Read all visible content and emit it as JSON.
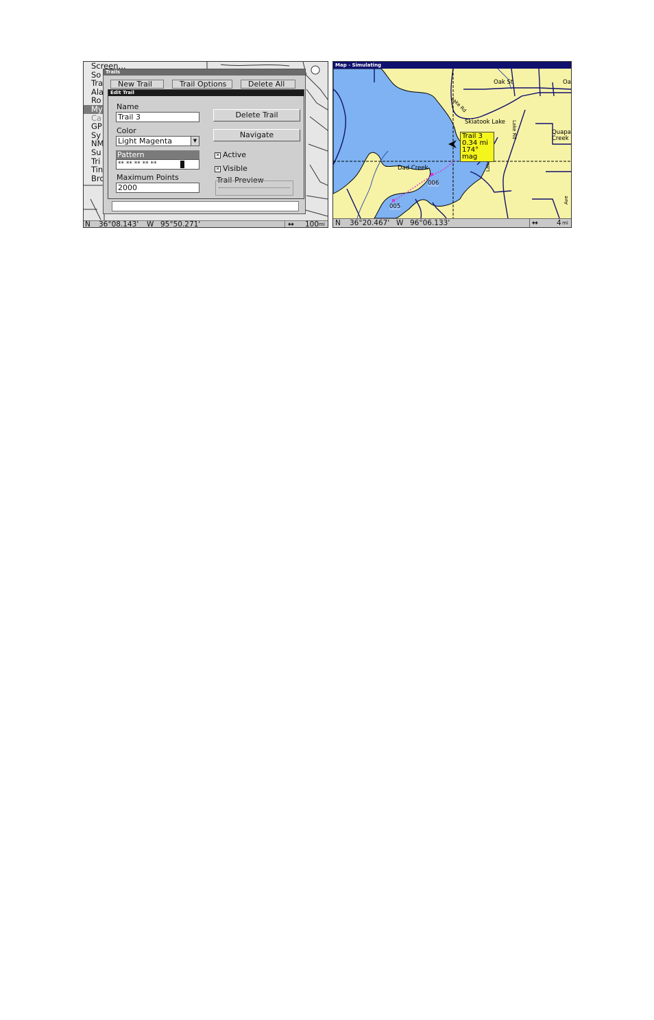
{
  "left_screen": {
    "menu_items": [
      {
        "label": "Screen...",
        "state": "normal"
      },
      {
        "label": "So",
        "state": "normal"
      },
      {
        "label": "Tra",
        "state": "normal"
      },
      {
        "label": "Ala",
        "state": "normal"
      },
      {
        "label": "Ro",
        "state": "normal"
      },
      {
        "label": "My",
        "state": "selected"
      },
      {
        "label": "Ca",
        "state": "dim"
      },
      {
        "label": "GP",
        "state": "normal"
      },
      {
        "label": "Sy",
        "state": "normal"
      },
      {
        "label": "NM",
        "state": "normal"
      },
      {
        "label": "Su",
        "state": "normal"
      },
      {
        "label": "Tri",
        "state": "normal"
      },
      {
        "label": "Tin",
        "state": "normal"
      },
      {
        "label": "Bro",
        "state": "normal"
      }
    ],
    "trails_dialog": {
      "title": "Trails",
      "buttons": [
        "New Trail",
        "Trail Options",
        "Delete All"
      ]
    },
    "edit_trail": {
      "title": "Edit Trail",
      "name_label": "Name",
      "name_value": "Trail 3",
      "color_label": "Color",
      "color_value": "Light Magenta",
      "pattern_label": "Pattern",
      "pattern_value": "** ** ** ** **",
      "max_points_label": "Maximum Points",
      "max_points_value": "2000",
      "delete_button": "Delete Trail",
      "navigate_button": "Navigate",
      "active_label": "Active",
      "visible_label": "Visible",
      "active_checked": true,
      "visible_checked": true,
      "preview_label": "Trail Preview"
    },
    "status": {
      "lat_hemi": "N",
      "lat": "36°08.143'",
      "lon_hemi": "W",
      "lon": "95°50.271'",
      "zoom_arrow": "↔",
      "zoom_value": "100",
      "zoom_unit": "mi"
    }
  },
  "right_screen": {
    "title": "Map - Simulating",
    "labels": {
      "oak_st": "Oak St",
      "oak_right": "Oa",
      "skiatook": "Skiatook Lake",
      "lake_rd_top": "Lake Rd",
      "lake_rd_bottom": "Lake Rd",
      "quapaw": "Quapa",
      "creek": "Creek",
      "dad_creek": "Dad Creek",
      "wp_006": "006",
      "wp_005": "005",
      "lake_rd_diag": "Lake Rd",
      "ave": "Ave"
    },
    "popup": {
      "line1": "Trail 3",
      "line2": "0.34 mi",
      "line3": "174° mag"
    },
    "status": {
      "lat_hemi": "N",
      "lat": "36°20.467'",
      "lon_hemi": "W",
      "lon": "96°06.133'",
      "zoom_arrow": "↔",
      "zoom_value": "4",
      "zoom_unit": "mi"
    },
    "colors": {
      "water": "#7eb2f2",
      "land": "#f7f3a6",
      "title_bar": "#10106e",
      "trail": "#d23cd2",
      "popup": "#f5f51e"
    }
  }
}
